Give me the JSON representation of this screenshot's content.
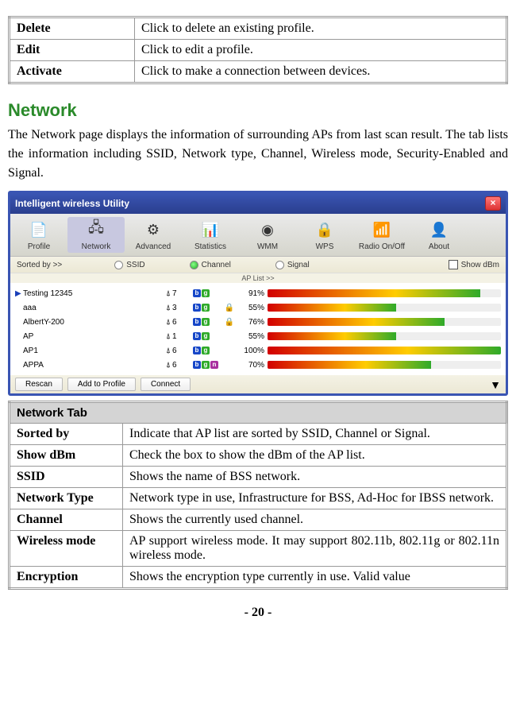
{
  "top_table": {
    "rows": [
      {
        "key": "Delete",
        "desc": "Click to delete an existing profile."
      },
      {
        "key": "Edit",
        "desc": "Click to edit a profile."
      },
      {
        "key": "Activate",
        "desc": "Click to make a connection between devices."
      }
    ]
  },
  "section_title": "Network",
  "body_paragraph": "The Network page displays the information of surrounding APs from last scan result. The tab lists the information including SSID, Network type, Channel, Wireless mode, Security-Enabled and Signal.",
  "app": {
    "title": "Intelligent wireless Utility",
    "close_label": "×",
    "tabs": [
      {
        "name": "Profile",
        "icon": "📄"
      },
      {
        "name": "Network",
        "icon": "🖧"
      },
      {
        "name": "Advanced",
        "icon": "⚙"
      },
      {
        "name": "Statistics",
        "icon": "📊"
      },
      {
        "name": "WMM",
        "icon": "◉"
      },
      {
        "name": "WPS",
        "icon": "🔒"
      },
      {
        "name": "Radio On/Off",
        "icon": "📶"
      },
      {
        "name": "About",
        "icon": "👤"
      }
    ],
    "sortbar": {
      "label": "Sorted by >>",
      "ssid": "SSID",
      "channel": "Channel",
      "signal": "Signal",
      "showdbm": "Show dBm"
    },
    "aplist_header": "AP List >>",
    "aps": [
      {
        "selected": true,
        "ssid": "Testing 12345",
        "ch": "7",
        "modes": [
          "b",
          "g"
        ],
        "lock": false,
        "pct": "91%",
        "fill": 91
      },
      {
        "selected": false,
        "ssid": "aaa",
        "ch": "3",
        "modes": [
          "b",
          "g"
        ],
        "lock": true,
        "pct": "55%",
        "fill": 55
      },
      {
        "selected": false,
        "ssid": "AlbertY-200",
        "ch": "6",
        "modes": [
          "b",
          "g"
        ],
        "lock": true,
        "pct": "76%",
        "fill": 76
      },
      {
        "selected": false,
        "ssid": "AP",
        "ch": "1",
        "modes": [
          "b",
          "g"
        ],
        "lock": false,
        "pct": "55%",
        "fill": 55
      },
      {
        "selected": false,
        "ssid": "AP1",
        "ch": "6",
        "modes": [
          "b",
          "g"
        ],
        "lock": false,
        "pct": "100%",
        "fill": 100
      },
      {
        "selected": false,
        "ssid": "APPA",
        "ch": "6",
        "modes": [
          "b",
          "g",
          "n"
        ],
        "lock": false,
        "pct": "70%",
        "fill": 70
      }
    ],
    "buttons": {
      "rescan": "Rescan",
      "add": "Add to Profile",
      "connect": "Connect"
    }
  },
  "network_tab": {
    "header": "Network Tab",
    "rows": [
      {
        "key": "Sorted by",
        "desc": "Indicate that AP list are sorted by SSID, Channel or Signal."
      },
      {
        "key": "Show dBm",
        "desc": "Check the box to show the dBm of the AP list."
      },
      {
        "key": "SSID",
        "desc": "Shows the name of BSS network."
      },
      {
        "key": "Network Type",
        "desc": "Network type in use, Infrastructure for BSS, Ad-Hoc for IBSS network."
      },
      {
        "key": "Channel",
        "desc": "Shows the currently used channel."
      },
      {
        "key": "Wireless mode",
        "desc": "AP support wireless mode. It may support 802.11b, 802.11g or 802.11n wireless mode."
      },
      {
        "key": "Encryption",
        "desc": "Shows the encryption type currently in use. Valid value"
      }
    ]
  },
  "page_number": "- 20 -"
}
